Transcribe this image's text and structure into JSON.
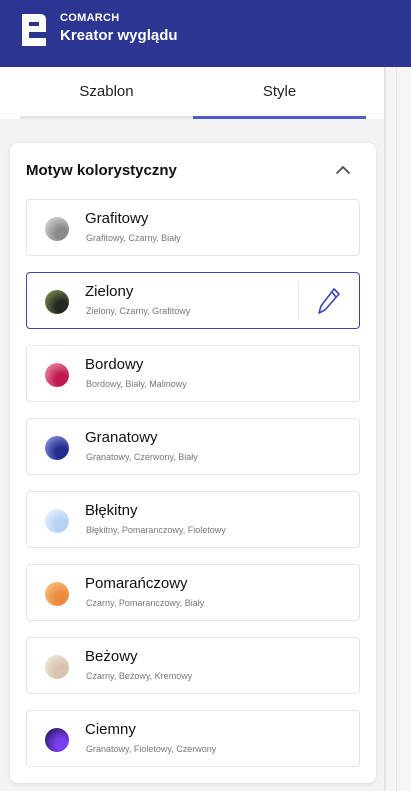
{
  "header": {
    "brand": "COMARCH",
    "title": "Kreator wyglądu",
    "logo_icon": "comarch-e-logo"
  },
  "tabs": [
    {
      "label": "Szablon",
      "active": false
    },
    {
      "label": "Style",
      "active": true
    }
  ],
  "section": {
    "title": "Motyw kolorystyczny",
    "collapse_icon": "chevron-up-icon"
  },
  "themes": [
    {
      "name": "Grafitowy",
      "colors": "Grafitowy, Czarny, Biały",
      "swatch": [
        "#e6e6e6",
        "#8a8a8a"
      ]
    },
    {
      "name": "Zielony",
      "colors": "Zielony, Czarny, Grafitowy",
      "swatch": [
        "#8fa25c",
        "#232820"
      ],
      "selected": true,
      "edit_icon": "pencil-icon"
    },
    {
      "name": "Bordowy",
      "colors": "Bordowy, Biały, Malinowy",
      "swatch": [
        "#f2a6bb",
        "#c0194d"
      ]
    },
    {
      "name": "Granatowy",
      "colors": "Granatowy, Czerwony, Biały",
      "swatch": [
        "#9fa6ee",
        "#252d8c"
      ]
    },
    {
      "name": "Błękitny",
      "colors": "Błękitny, Pomaranczowy, Fioletowy",
      "swatch": [
        "#f3f7ff",
        "#b5d2f3"
      ]
    },
    {
      "name": "Pomarańczowy",
      "colors": "Czarny, Pomaranczowy, Biały",
      "swatch": [
        "#f9cb8b",
        "#ec8b3f"
      ]
    },
    {
      "name": "Beżowy",
      "colors": "Czarny, Beżowy, Kremowy",
      "swatch": [
        "#f7efe7",
        "#d6c2ae"
      ]
    },
    {
      "name": "Ciemny",
      "colors": "Granatowy, Fioletowy, Czerwony",
      "swatch": [
        "#16163a",
        "#7a3df0"
      ]
    }
  ],
  "colors": {
    "header_bg": "#2c3592",
    "accent": "#4e5bcc",
    "selected_border": "#3a45b0"
  }
}
